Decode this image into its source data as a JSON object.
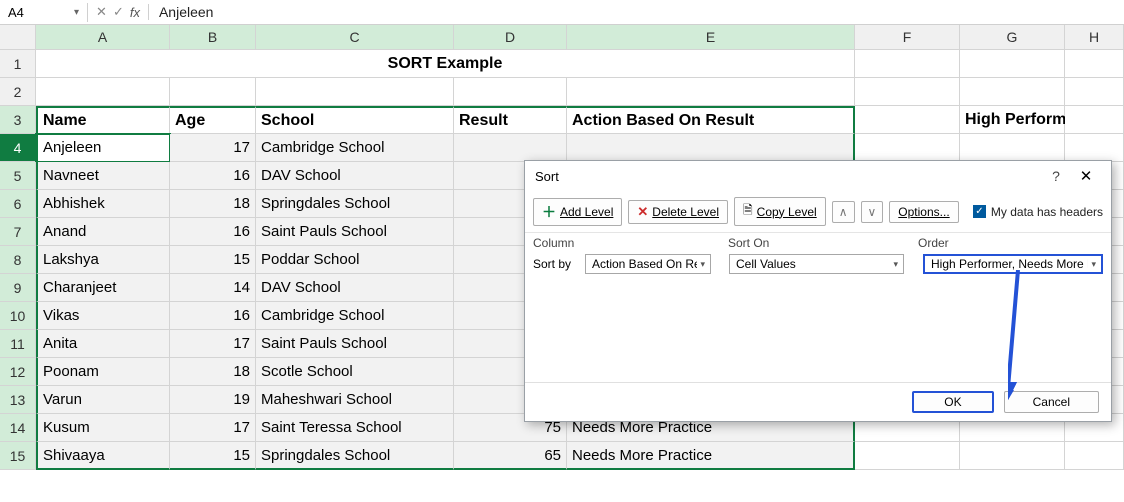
{
  "formula_bar": {
    "name_box": "A4",
    "cancel_glyph": "✕",
    "confirm_glyph": "✓",
    "fx_label": "fx",
    "value": "Anjeleen"
  },
  "columns": [
    "A",
    "B",
    "C",
    "D",
    "E",
    "F",
    "G",
    "H"
  ],
  "rows": [
    "1",
    "2",
    "3",
    "4",
    "5",
    "6",
    "7",
    "8",
    "9",
    "10",
    "11",
    "12",
    "13",
    "14",
    "15"
  ],
  "title": "SORT Example",
  "headers": {
    "name": "Name",
    "age": "Age",
    "school": "School",
    "result": "Result",
    "action": "Action Based On Result",
    "hp": "High Performer"
  },
  "data": [
    {
      "name": "Anjeleen",
      "age": "17",
      "school": "Cambridge School",
      "result": "",
      "action": ""
    },
    {
      "name": "Navneet",
      "age": "16",
      "school": "DAV School",
      "result": "",
      "action": ""
    },
    {
      "name": "Abhishek",
      "age": "18",
      "school": "Springdales School",
      "result": "",
      "action": ""
    },
    {
      "name": "Anand",
      "age": "16",
      "school": "Saint Pauls School",
      "result": "",
      "action": ""
    },
    {
      "name": "Lakshya",
      "age": "15",
      "school": "Poddar School",
      "result": "",
      "action": ""
    },
    {
      "name": "Charanjeet",
      "age": "14",
      "school": "DAV School",
      "result": "",
      "action": ""
    },
    {
      "name": "Vikas",
      "age": "16",
      "school": "Cambridge School",
      "result": "",
      "action": ""
    },
    {
      "name": "Anita",
      "age": "17",
      "school": "Saint Pauls School",
      "result": "",
      "action": ""
    },
    {
      "name": "Poonam",
      "age": "18",
      "school": "Scotle School",
      "result": "",
      "action": ""
    },
    {
      "name": "Varun",
      "age": "19",
      "school": "Maheshwari School",
      "result": "",
      "action": ""
    },
    {
      "name": "Kusum",
      "age": "17",
      "school": "Saint Teressa School",
      "result": "75",
      "action": "Needs More Practice"
    },
    {
      "name": "Shivaaya",
      "age": "15",
      "school": "Springdales School",
      "result": "65",
      "action": "Needs More Practice"
    }
  ],
  "dialog": {
    "title": "Sort",
    "help_glyph": "?",
    "close_glyph": "✕",
    "add_level": "Add Level",
    "delete_level": "Delete Level",
    "copy_level": "Copy Level",
    "options": "Options...",
    "my_data_has_headers": "My data has headers",
    "col_label": "Column",
    "sorton_label": "Sort On",
    "order_label": "Order",
    "sort_by": "Sort by",
    "sort_col": "Action Based On Res",
    "sort_on": "Cell Values",
    "sort_order": "High Performer, Needs More Pr",
    "ok": "OK",
    "cancel": "Cancel",
    "up_glyph": "∧",
    "down_glyph": "∨",
    "dd_glyph": "▾",
    "add_glyph": "＋",
    "del_glyph": "✕",
    "copy_glyph": "🗎"
  }
}
